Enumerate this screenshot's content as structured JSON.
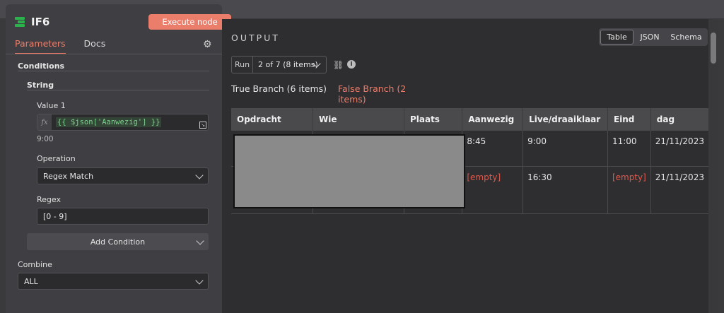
{
  "node": {
    "title": "IF6",
    "execute_label": "Execute node",
    "tabs": [
      "Parameters",
      "Docs"
    ]
  },
  "params": {
    "conditions_label": "Conditions",
    "string_label": "String",
    "value1_label": "Value 1",
    "value1_fx": "fx",
    "value1_expression": "{{ $json['Aanwezig'] }}",
    "value1_hint": "9:00",
    "operation_label": "Operation",
    "operation_value": "Regex Match",
    "regex_label": "Regex",
    "regex_value": "[0 - 9]",
    "add_condition_label": "Add Condition",
    "combine_label": "Combine",
    "combine_value": "ALL"
  },
  "output": {
    "title": "OUTPUT",
    "views": [
      "Table",
      "JSON",
      "Schema"
    ],
    "active_view": "Table",
    "run_label": "Run",
    "run_value": "2 of 7 (8 items)",
    "branches": {
      "true_label": "True Branch (6 items)",
      "false_label": "False Branch (2 items)"
    },
    "columns": [
      "Opdracht",
      "Wie",
      "Plaats",
      "Aanwezig",
      "Live/draaiklaar",
      "Eind",
      "dag"
    ],
    "rows": [
      {
        "opdracht": "",
        "wie": "",
        "plaats": "",
        "aanwezig": "8:45",
        "live": "9:00",
        "eind": "11:00",
        "dag": "21/11/2023"
      },
      {
        "opdracht": "",
        "wie": "",
        "plaats": "",
        "aanwezig": "[empty]",
        "live": "16:30",
        "eind": "[empty]",
        "dag": "21/11/2023"
      }
    ]
  },
  "colors": {
    "accent": "#ef7c68",
    "empty_value": "#e0584a",
    "node_icon": "#2bb24c"
  }
}
